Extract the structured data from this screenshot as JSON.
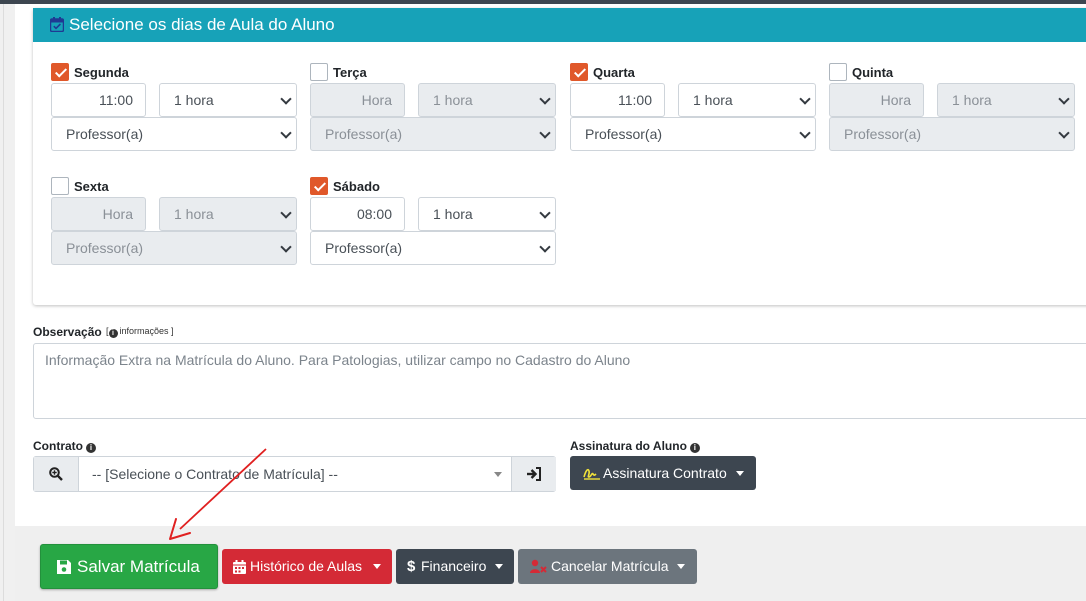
{
  "header": {
    "title": "Selecione os dias de Aula do Aluno",
    "icon": "calendar-check-icon",
    "color": "#17a2b8"
  },
  "days": [
    {
      "label": "Segunda",
      "checked": true,
      "time": "11:00",
      "duration": "1 hora",
      "professor": "Professor(a)"
    },
    {
      "label": "Terça",
      "checked": false,
      "time": "Hora",
      "duration": "1 hora",
      "professor": "Professor(a)"
    },
    {
      "label": "Quarta",
      "checked": true,
      "time": "11:00",
      "duration": "1 hora",
      "professor": "Professor(a)"
    },
    {
      "label": "Quinta",
      "checked": false,
      "time": "Hora",
      "duration": "1 hora",
      "professor": "Professor(a)"
    },
    {
      "label": "Sexta",
      "checked": false,
      "time": "Hora",
      "duration": "1 hora",
      "professor": "Professor(a)"
    },
    {
      "label": "Sábado",
      "checked": true,
      "time": "08:00",
      "duration": "1 hora",
      "professor": "Professor(a)"
    }
  ],
  "observacao": {
    "label": "Observação",
    "info_prefix": "[",
    "info_text": "informações ]",
    "placeholder": "Informação Extra na Matrícula do Aluno. Para Patologias, utilizar campo no Cadastro do Aluno"
  },
  "contrato": {
    "label": "Contrato",
    "placeholder": "-- [Selecione o Contrato de Matrícula] --"
  },
  "assinatura": {
    "label": "Assinatura do Aluno",
    "button": "Assinatura Contrato"
  },
  "footer": {
    "save": "Salvar Matrícula",
    "historico": "Histórico de Aulas",
    "financeiro": "Financeiro",
    "cancelar": "Cancelar Matrícula"
  },
  "colors": {
    "check": "#e0582a",
    "save": "#28a745",
    "historico": "#d42a36",
    "dark": "#3d4650",
    "cancel": "#6c757d",
    "annotation_arrow": "#e02020"
  }
}
